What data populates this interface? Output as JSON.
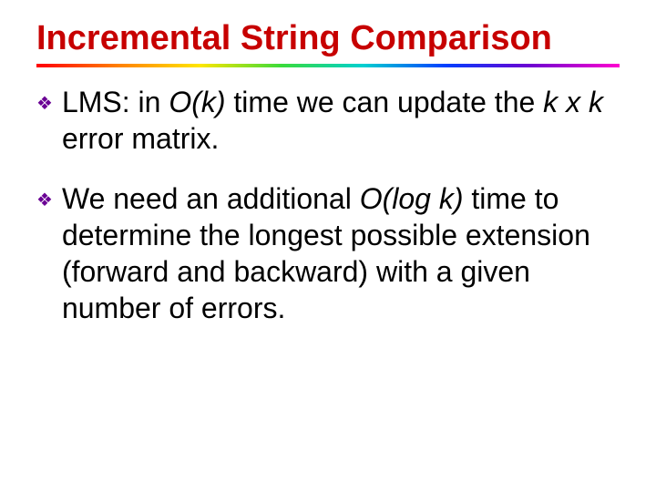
{
  "title": "Incremental String Comparison",
  "bullets": [
    {
      "segs": [
        {
          "t": "LMS:  in ",
          "i": false
        },
        {
          "t": "O(k)",
          "i": true
        },
        {
          "t": " time we can update the ",
          "i": false
        },
        {
          "t": "k x k",
          "i": true
        },
        {
          "t": " error matrix.",
          "i": false
        }
      ]
    },
    {
      "segs": [
        {
          "t": "We need an additional ",
          "i": false
        },
        {
          "t": "O(log k)",
          "i": true
        },
        {
          "t": " time to determine the longest possible extension (forward and backward) with a given number of errors.",
          "i": false
        }
      ]
    }
  ]
}
